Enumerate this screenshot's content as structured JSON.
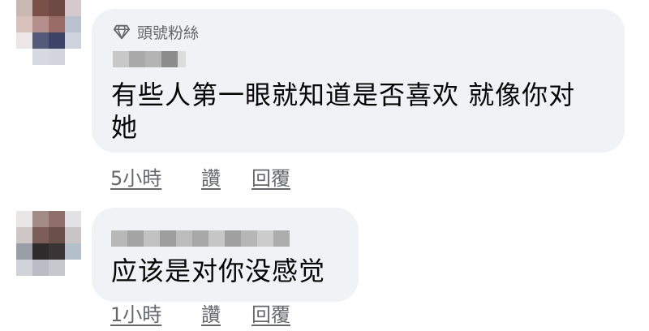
{
  "comments": [
    {
      "badge": "頭號粉絲",
      "badge_icon": "diamond-icon",
      "text_line1": "有些人第一眼就知道是否喜欢 就像你对",
      "text_line2": "她",
      "time": "5小時",
      "read": "讚",
      "reply": "回覆"
    },
    {
      "text_line1": "应该是对你没感觉",
      "time": "1小時",
      "read": "讚",
      "reply": "回覆"
    }
  ]
}
